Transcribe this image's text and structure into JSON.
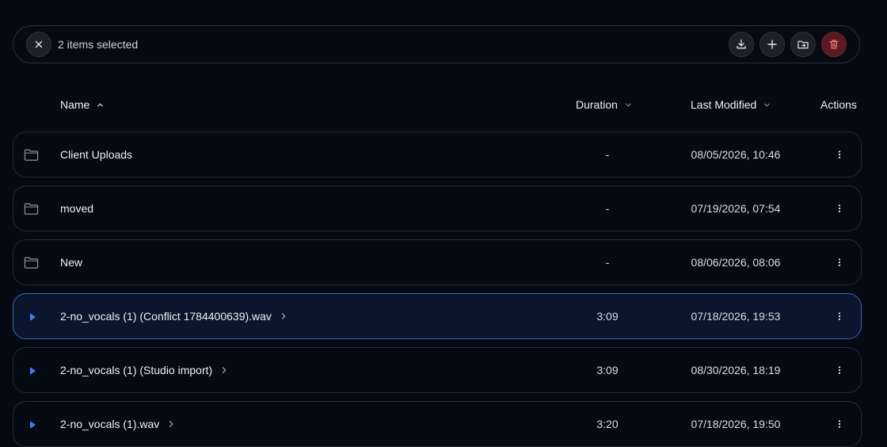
{
  "selection": {
    "count_text": "2 items selected",
    "actions": [
      "download-icon",
      "add-icon",
      "move-to-folder-icon",
      "trash-icon"
    ],
    "danger_color": "#f07a7a"
  },
  "table": {
    "columns": {
      "name": "Name",
      "duration": "Duration",
      "last_modified": "Last Modified",
      "actions": "Actions"
    },
    "rows": [
      {
        "type": "folder",
        "name": "Client Uploads",
        "duration": "-",
        "modified": "08/05/2026, 10:46",
        "selected": false
      },
      {
        "type": "folder",
        "name": "moved",
        "duration": "-",
        "modified": "07/19/2026, 07:54",
        "selected": false
      },
      {
        "type": "folder",
        "name": "New",
        "duration": "-",
        "modified": "08/06/2026, 08:06",
        "selected": false
      },
      {
        "type": "audio",
        "name": "2-no_vocals (1) (Conflict 1784400639).wav",
        "duration": "3:09",
        "modified": "07/18/2026, 19:53",
        "selected": true
      },
      {
        "type": "audio",
        "name": "2-no_vocals (1) (Studio import)",
        "duration": "3:09",
        "modified": "08/30/2026, 18:19",
        "selected": false
      },
      {
        "type": "audio",
        "name": "2-no_vocals (1).wav",
        "duration": "3:20",
        "modified": "07/18/2026, 19:50",
        "selected": false
      }
    ]
  },
  "colors": {
    "background": "#060a13",
    "accent": "#3a66b8",
    "play_icon": "#3b82f6"
  }
}
